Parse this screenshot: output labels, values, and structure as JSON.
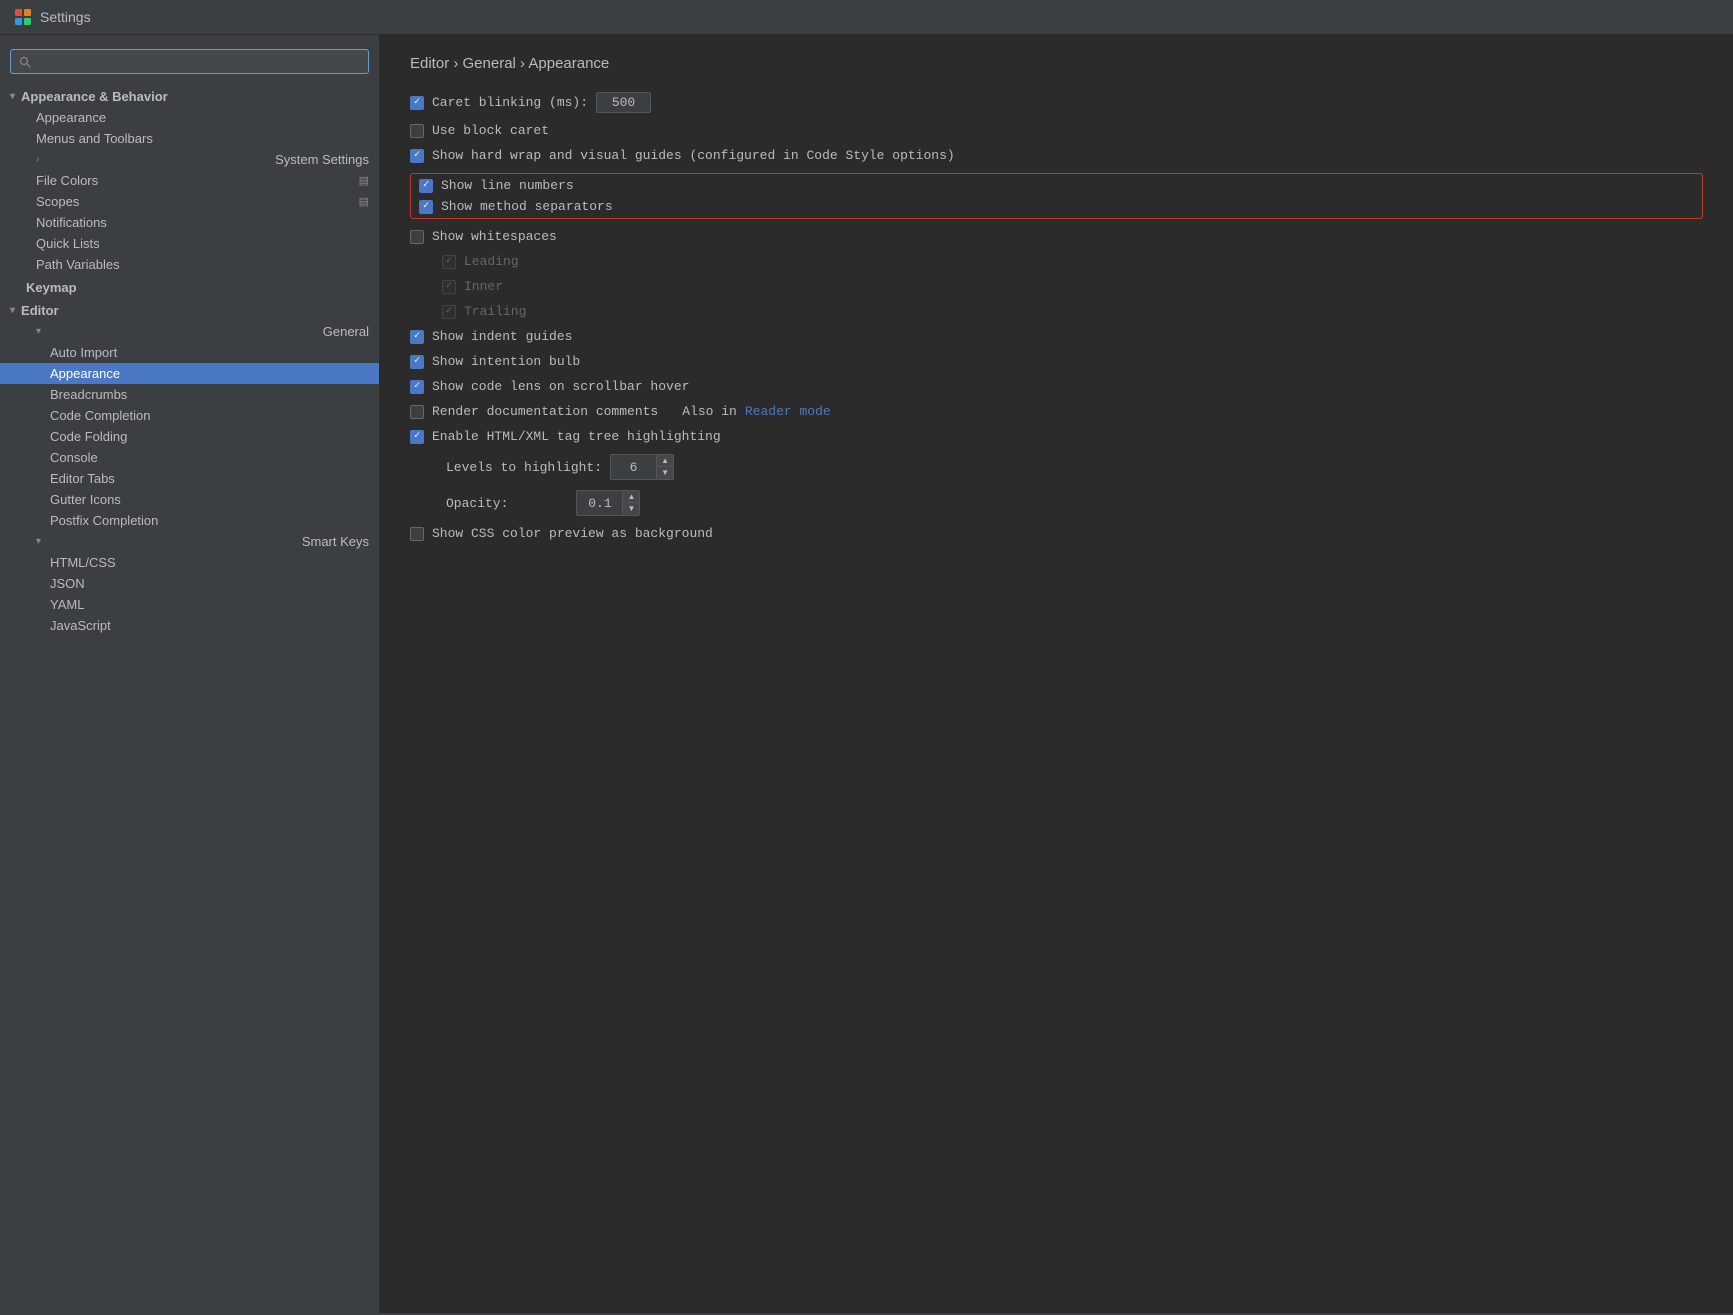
{
  "titleBar": {
    "title": "Settings",
    "iconColor": "#e74c3c"
  },
  "sidebar": {
    "searchPlaceholder": "",
    "groups": [
      {
        "id": "appearance-behavior",
        "label": "Appearance & Behavior",
        "expanded": true,
        "indent": 0,
        "children": [
          {
            "id": "appearance",
            "label": "Appearance",
            "indent": 1,
            "icon": null
          },
          {
            "id": "menus-toolbars",
            "label": "Menus and Toolbars",
            "indent": 1,
            "icon": null
          },
          {
            "id": "system-settings",
            "label": "System Settings",
            "indent": 1,
            "expandable": true
          },
          {
            "id": "file-colors",
            "label": "File Colors",
            "indent": 1,
            "icon": "settings"
          },
          {
            "id": "scopes",
            "label": "Scopes",
            "indent": 1,
            "icon": "settings"
          },
          {
            "id": "notifications",
            "label": "Notifications",
            "indent": 1
          },
          {
            "id": "quick-lists",
            "label": "Quick Lists",
            "indent": 1
          },
          {
            "id": "path-variables",
            "label": "Path Variables",
            "indent": 1
          }
        ]
      },
      {
        "id": "keymap",
        "label": "Keymap",
        "expanded": false,
        "indent": 0,
        "plain": true
      },
      {
        "id": "editor",
        "label": "Editor",
        "expanded": true,
        "indent": 0,
        "children": [
          {
            "id": "general",
            "label": "General",
            "indent": 1,
            "expanded": true,
            "children": [
              {
                "id": "auto-import",
                "label": "Auto Import",
                "indent": 2
              },
              {
                "id": "appearance-editor",
                "label": "Appearance",
                "indent": 2,
                "active": true
              },
              {
                "id": "breadcrumbs",
                "label": "Breadcrumbs",
                "indent": 2
              },
              {
                "id": "code-completion",
                "label": "Code Completion",
                "indent": 2
              },
              {
                "id": "code-folding",
                "label": "Code Folding",
                "indent": 2
              },
              {
                "id": "console",
                "label": "Console",
                "indent": 2
              },
              {
                "id": "editor-tabs",
                "label": "Editor Tabs",
                "indent": 2
              },
              {
                "id": "gutter-icons",
                "label": "Gutter Icons",
                "indent": 2
              },
              {
                "id": "postfix-completion",
                "label": "Postfix Completion",
                "indent": 2
              }
            ]
          },
          {
            "id": "smart-keys",
            "label": "Smart Keys",
            "indent": 1,
            "expanded": true,
            "children": [
              {
                "id": "html-css",
                "label": "HTML/CSS",
                "indent": 2
              },
              {
                "id": "json",
                "label": "JSON",
                "indent": 2
              },
              {
                "id": "yaml",
                "label": "YAML",
                "indent": 2
              },
              {
                "id": "javascript",
                "label": "JavaScript",
                "indent": 2
              }
            ]
          }
        ]
      }
    ]
  },
  "content": {
    "breadcrumb": "Editor  ›  General  ›  Appearance",
    "settings": [
      {
        "id": "caret-blinking",
        "checked": true,
        "label": "Caret blinking (ms):",
        "hasInput": true,
        "inputValue": "500"
      },
      {
        "id": "block-caret",
        "checked": false,
        "label": "Use block caret"
      },
      {
        "id": "hard-wrap",
        "checked": true,
        "label": "Show hard wrap and visual guides (configured in Code Style options)"
      },
      {
        "id": "highlight-group",
        "isGroup": true,
        "items": [
          {
            "id": "show-line-numbers",
            "checked": true,
            "label": "Show line numbers"
          },
          {
            "id": "show-method-separators",
            "checked": true,
            "label": "Show method separators"
          }
        ]
      },
      {
        "id": "show-whitespaces",
        "checked": false,
        "label": "Show whitespaces"
      },
      {
        "id": "leading",
        "checked": true,
        "label": "Leading",
        "indented": true,
        "disabled": true
      },
      {
        "id": "inner",
        "checked": true,
        "label": "Inner",
        "indented": true,
        "disabled": true
      },
      {
        "id": "trailing",
        "checked": true,
        "label": "Trailing",
        "indented": true,
        "disabled": true
      },
      {
        "id": "indent-guides",
        "checked": true,
        "label": "Show indent guides"
      },
      {
        "id": "intention-bulb",
        "checked": true,
        "label": "Show intention bulb"
      },
      {
        "id": "code-lens",
        "checked": true,
        "label": "Show code lens on scrollbar hover"
      },
      {
        "id": "render-docs",
        "checked": false,
        "label": "Render documentation comments",
        "hasLink": true,
        "linkPrefix": "Also in ",
        "linkText": "Reader mode"
      },
      {
        "id": "html-xml-highlight",
        "checked": true,
        "label": "Enable HTML/XML tag tree highlighting"
      },
      {
        "id": "levels-highlight",
        "isSpinner": true,
        "label": "Levels to highlight:",
        "value": "6",
        "indent": "large"
      },
      {
        "id": "opacity",
        "isSpinner": true,
        "label": "Opacity:",
        "value": "0.1",
        "indent": "large"
      },
      {
        "id": "css-color-preview",
        "checked": false,
        "label": "Show CSS color preview as background"
      }
    ]
  },
  "icons": {
    "search": "🔍",
    "chevronDown": "▾",
    "chevronRight": "›",
    "settings": "▤",
    "appIcon": "◉"
  }
}
